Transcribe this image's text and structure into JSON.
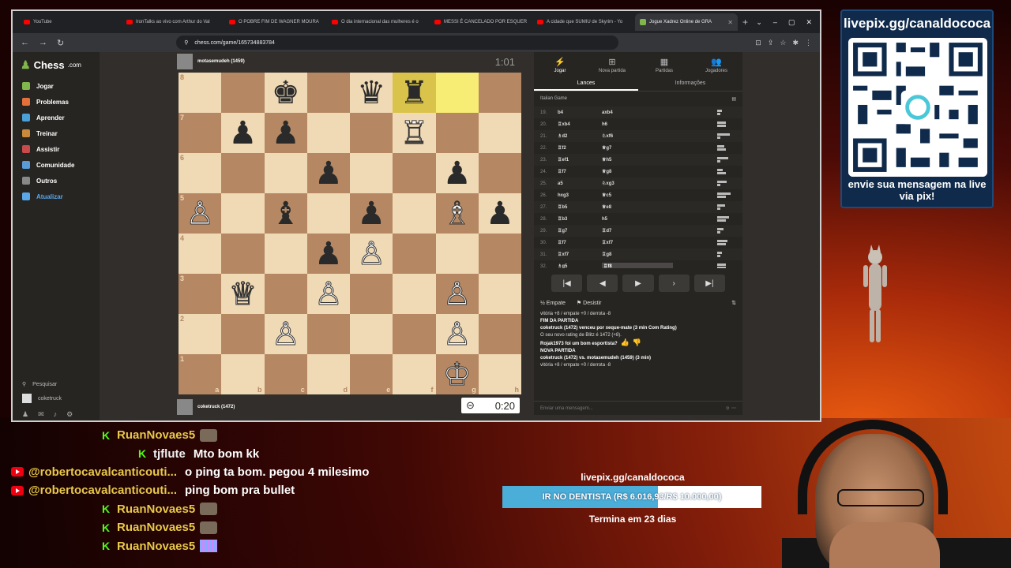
{
  "browser": {
    "tabs": [
      {
        "label": "YouTube",
        "type": "yt"
      },
      {
        "label": "IronTalks ao vivo com Arthur do Val",
        "type": "yt"
      },
      {
        "label": "O POBRE FIM DE WAGNER MOURA",
        "type": "yt"
      },
      {
        "label": "O dia internacional das mulheres é o",
        "type": "yt"
      },
      {
        "label": "MESSI É CANCELADO POR ESQUER",
        "type": "yt"
      },
      {
        "label": "A cidade que SUMIU de Skyrim - Yo",
        "type": "yt"
      },
      {
        "label": "Jogue Xadrez Online de GRA",
        "type": "chess",
        "active": true
      }
    ],
    "url": "chess.com/game/165734883784"
  },
  "sidebar": {
    "logo": "Chess",
    "logo_suffix": ".com",
    "items": [
      {
        "label": "Jogar",
        "color": "#81b64c"
      },
      {
        "label": "Problemas",
        "color": "#e5703a"
      },
      {
        "label": "Aprender",
        "color": "#4aa0d8"
      },
      {
        "label": "Treinar",
        "color": "#ca8a3a"
      },
      {
        "label": "Assistir",
        "color": "#c84a4a"
      },
      {
        "label": "Comunidade",
        "color": "#5a9ad8"
      },
      {
        "label": "Outros",
        "color": "#888888"
      },
      {
        "label": "Atualizar",
        "color": "#5aa7e8"
      }
    ],
    "search": "Pesquisar",
    "user": "coketruck"
  },
  "players": {
    "top": {
      "name": "motasemudeh (1459)",
      "clock": "1:01"
    },
    "bottom": {
      "name": "coketruck (1472)",
      "clock": "0:20"
    }
  },
  "board": {
    "ranks": [
      "8",
      "7",
      "6",
      "5",
      "4",
      "3",
      "2",
      "1"
    ],
    "files": [
      "a",
      "b",
      "c",
      "d",
      "e",
      "f",
      "g",
      "h"
    ],
    "pieces": [
      [
        "",
        "",
        "♚",
        "",
        "♛",
        "♜",
        "",
        ""
      ],
      [
        "",
        "♟",
        "♟",
        "",
        "",
        "♖",
        "",
        ""
      ],
      [
        "",
        "",
        "",
        "♟",
        "",
        "",
        "♟",
        ""
      ],
      [
        "♙",
        "",
        "♝",
        "",
        "♟",
        "",
        "♗",
        "♟"
      ],
      [
        "",
        "",
        "",
        "♟",
        "♙",
        "",
        "",
        ""
      ],
      [
        "",
        "♕",
        "",
        "♙",
        "",
        "",
        "♙",
        ""
      ],
      [
        "",
        "",
        "♙",
        "",
        "",
        "",
        "♙",
        ""
      ],
      [
        "",
        "",
        "",
        "",
        "",
        "",
        "♔",
        ""
      ]
    ],
    "highlights": [
      [
        0,
        5
      ],
      [
        0,
        6
      ]
    ]
  },
  "panel": {
    "tabs": [
      {
        "label": "Jogar",
        "icon": "⚡"
      },
      {
        "label": "Nova partida",
        "icon": "⊞"
      },
      {
        "label": "Partidas",
        "icon": "▦"
      },
      {
        "label": "Jogadores",
        "icon": "👥"
      }
    ],
    "subtabs": [
      "Lances",
      "Informações"
    ],
    "opening": "Italian Game",
    "moves": [
      {
        "n": "19.",
        "w": "b4",
        "b": "axb4"
      },
      {
        "n": "20.",
        "w": "♖xb4",
        "b": "h6"
      },
      {
        "n": "21.",
        "w": "♗d2",
        "b": "♘xf6"
      },
      {
        "n": "22.",
        "w": "♖f2",
        "b": "♕g7"
      },
      {
        "n": "23.",
        "w": "♖ef1",
        "b": "♕h5"
      },
      {
        "n": "24.",
        "w": "♖f7",
        "b": "♕g8"
      },
      {
        "n": "25.",
        "w": "a5",
        "b": "♘xg3"
      },
      {
        "n": "26.",
        "w": "hxg3",
        "b": "♕c5"
      },
      {
        "n": "27.",
        "w": "♖b5",
        "b": "♕e8"
      },
      {
        "n": "28.",
        "w": "♖b3",
        "b": "h5"
      },
      {
        "n": "29.",
        "w": "♖g7",
        "b": "♖d7"
      },
      {
        "n": "30.",
        "w": "♖f7",
        "b": "♖xf7"
      },
      {
        "n": "31.",
        "w": "♖xf7",
        "b": "♖g8"
      },
      {
        "n": "32.",
        "w": "♗g5",
        "b": "♖f8",
        "current": true
      }
    ],
    "draw": "Empate",
    "resign": "Desistir",
    "log": [
      {
        "text": "vitória +8 / empate +0 / derrota -8",
        "bold": false
      },
      {
        "text": "FIM DA PARTIDA",
        "bold": true
      },
      {
        "text": "coketruck (1472) venceu por xeque-mate (3 min Com Rating)",
        "bold": true
      },
      {
        "text": "O seu novo rating de Blitz é 1472 (+8).",
        "bold": false
      },
      {
        "text": "Rojak1973 foi um bom esportista?",
        "bold": true,
        "thumbs": true
      },
      {
        "text": "NOVA PARTIDA",
        "bold": true
      },
      {
        "text": "coketruck (1472) vs. motasemudeh (1459) (3 min)",
        "bold": true
      },
      {
        "text": "vitória +8 / empate +0 / derrota -8",
        "bold": false
      }
    ],
    "chat_placeholder": "Enviar uma mensagem..."
  },
  "overlay": {
    "qr_title": "livepix.gg/canaldococa",
    "qr_caption": "envie sua mensagem na live via pix!"
  },
  "chat": [
    {
      "platform": "kick",
      "user": "RuanNovaes5",
      "msg": "",
      "emote": "face"
    },
    {
      "platform": "kick",
      "user": "tjflute",
      "msg": "Mto bom kk",
      "white": true
    },
    {
      "platform": "youtube",
      "user": "@robertocavalcanticouti...",
      "msg": "o ping ta bom. pegou 4 milesimo"
    },
    {
      "platform": "youtube",
      "user": "@robertocavalcanticouti...",
      "msg": "ping bom pra bullet"
    },
    {
      "platform": "kick",
      "user": "RuanNovaes5",
      "msg": "",
      "emote": "face"
    },
    {
      "platform": "kick",
      "user": "RuanNovaes5",
      "msg": "",
      "emote": "face"
    },
    {
      "platform": "kick",
      "user": "RuanNovaes5",
      "msg": "",
      "emote": "glitter"
    }
  ],
  "goal": {
    "site": "livepix.gg/canaldococa",
    "text": "IR NO DENTISTA (R$ 6.016,93/R$ 10.000,00)",
    "progress": 0.6017,
    "ends": "Termina em 23 dias"
  }
}
